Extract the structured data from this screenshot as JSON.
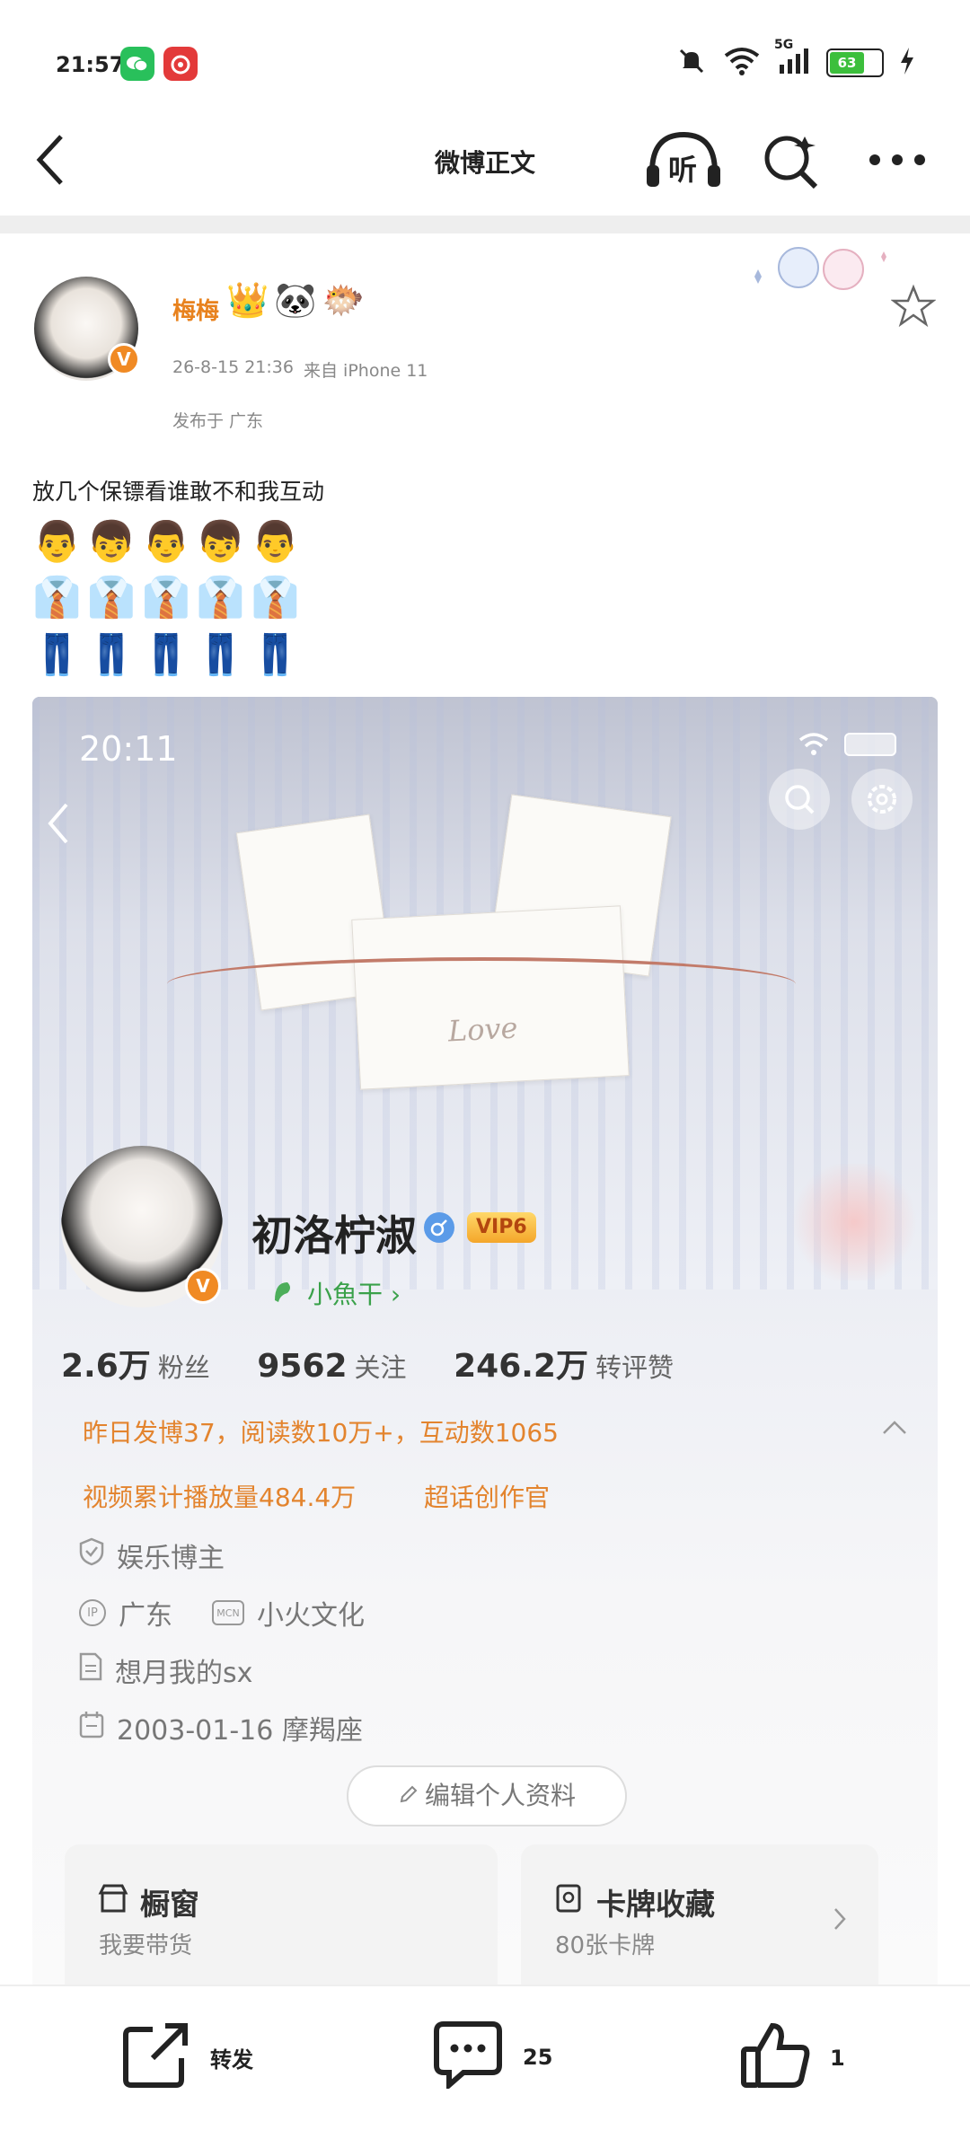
{
  "status_bar": {
    "time": "21:57",
    "network": "5G",
    "battery": "63",
    "icons": [
      "wechat-icon",
      "netease-music-icon",
      "mute-icon",
      "wifi-icon",
      "signal-icon",
      "battery-icon",
      "charging-icon"
    ]
  },
  "nav": {
    "title": "微博正文",
    "listen_label": "听"
  },
  "post": {
    "author": "梅梅",
    "date": "26-8-15 21:36",
    "source": "来自 iPhone 11",
    "location": "发布于 广东",
    "text": "放几个保镖看谁敢不和我互动",
    "emoji_rows": [
      "👨👦👨👦👨",
      "👔👔👔👔👔",
      "👖👖👖👖👖"
    ],
    "badges": [
      "👑",
      "🐼",
      "🐡"
    ]
  },
  "embedded_profile": {
    "time": "20:11",
    "name": "初洛柠淑",
    "vip": "VIP6",
    "tag": "小魚干 ›",
    "stats": [
      {
        "value": "2.6万",
        "label": "粉丝"
      },
      {
        "value": "9562",
        "label": "关注"
      },
      {
        "value": "246.2万",
        "label": "转评赞"
      }
    ],
    "activity": "昨日发博37，阅读数10万+，互动数1065",
    "video_plays": "视频累计播放量484.4万",
    "super_topic": "超话创作官",
    "info": [
      {
        "icon": "verified-icon",
        "text": "娱乐博主"
      },
      {
        "icon": "ip-icon",
        "text": "广东",
        "extra_icon": "mcn-icon",
        "extra": "小火文化"
      },
      {
        "icon": "document-icon",
        "text": "想月我的sx"
      },
      {
        "icon": "calendar-icon",
        "text": "2003-01-16 摩羯座"
      }
    ],
    "edit_button": "编辑个人资料",
    "cards": [
      {
        "title": "橱窗",
        "subtitle": "我要带货"
      },
      {
        "title": "卡牌收藏",
        "subtitle": "80张卡牌"
      }
    ],
    "banner_text": "Love"
  },
  "bottom_bar": {
    "repost": "转发",
    "comment_count": "25",
    "like_count": "1"
  },
  "colors": {
    "accent": "#e8821e",
    "orange_text": "#e3842e",
    "verified_blue": "#5b9be8"
  }
}
